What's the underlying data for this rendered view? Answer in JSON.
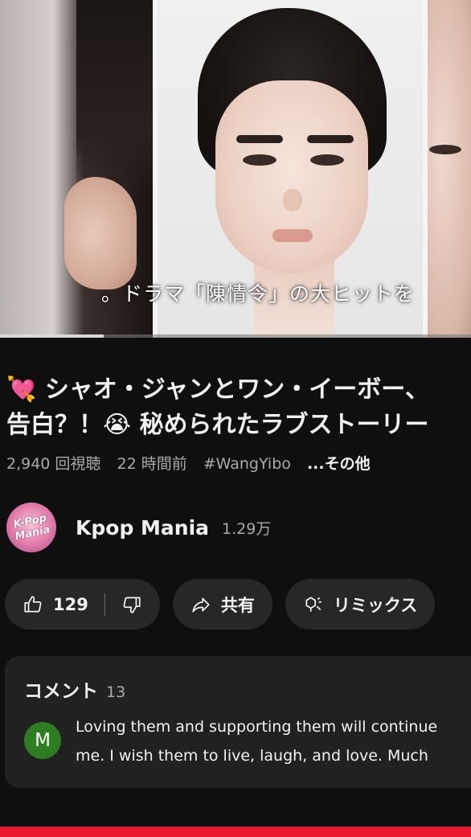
{
  "video": {
    "subtitle": "。ドラマ「陳情令」の大ヒットを",
    "progress_fraction": 0.22
  },
  "title": {
    "emoji": "💘",
    "line1": "シャオ・ジャンとワン・イーボー、",
    "line2_a": "告白？！",
    "emoji2": "😭",
    "line2_b": "秘められたラブストーリー"
  },
  "meta": {
    "views": "2,940 回視聴",
    "time": "22 時間前",
    "hashtag": "#WangYibo",
    "more": "...その他"
  },
  "channel": {
    "avatar_text": "K-Pop Mania",
    "name": "Kpop Mania",
    "subscribers": "1.29万"
  },
  "actions": {
    "likes": "129",
    "share": "共有",
    "remix": "リミックス"
  },
  "comments": {
    "header": "コメント",
    "count": "13",
    "avatar_letter": "M",
    "line1": "Loving them and supporting them will continue",
    "line2": "me. I wish them to live, laugh, and love. Much"
  },
  "colors": {
    "background": "#0f0f0f",
    "pill": "#272727",
    "comment_panel": "#212121",
    "accent_red": "#e8192c",
    "comment_avatar": "#2e7d23"
  }
}
